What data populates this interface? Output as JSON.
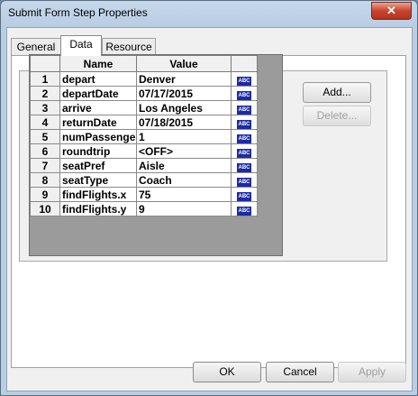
{
  "window": {
    "title": "Submit Form Step Properties",
    "close_label": "✕"
  },
  "tabs": [
    {
      "label": "General"
    },
    {
      "label": "Data"
    },
    {
      "label": "Resource"
    }
  ],
  "grid": {
    "headers": {
      "rownum": "",
      "name": "Name",
      "value": "Value",
      "type": ""
    },
    "rows": [
      {
        "num": "1",
        "name": "depart",
        "value": "Denver",
        "type": "ABC"
      },
      {
        "num": "2",
        "name": "departDate",
        "value": "07/17/2015",
        "type": "ABC"
      },
      {
        "num": "3",
        "name": "arrive",
        "value": "Los Angeles",
        "type": "ABC"
      },
      {
        "num": "4",
        "name": "returnDate",
        "value": "07/18/2015",
        "type": "ABC"
      },
      {
        "num": "5",
        "name": "numPassenger",
        "value": "1",
        "type": "ABC"
      },
      {
        "num": "6",
        "name": "roundtrip",
        "value": "<OFF>",
        "type": "ABC"
      },
      {
        "num": "7",
        "name": "seatPref",
        "value": "Aisle",
        "type": "ABC"
      },
      {
        "num": "8",
        "name": "seatType",
        "value": "Coach",
        "type": "ABC"
      },
      {
        "num": "9",
        "name": "findFlights.x",
        "value": "75",
        "type": "ABC"
      },
      {
        "num": "10",
        "name": "findFlights.y",
        "value": "9",
        "type": "ABC"
      }
    ]
  },
  "side_buttons": {
    "add": "Add...",
    "delete": "Delete..."
  },
  "footer": {
    "ok": "OK",
    "cancel": "Cancel",
    "apply": "Apply"
  }
}
